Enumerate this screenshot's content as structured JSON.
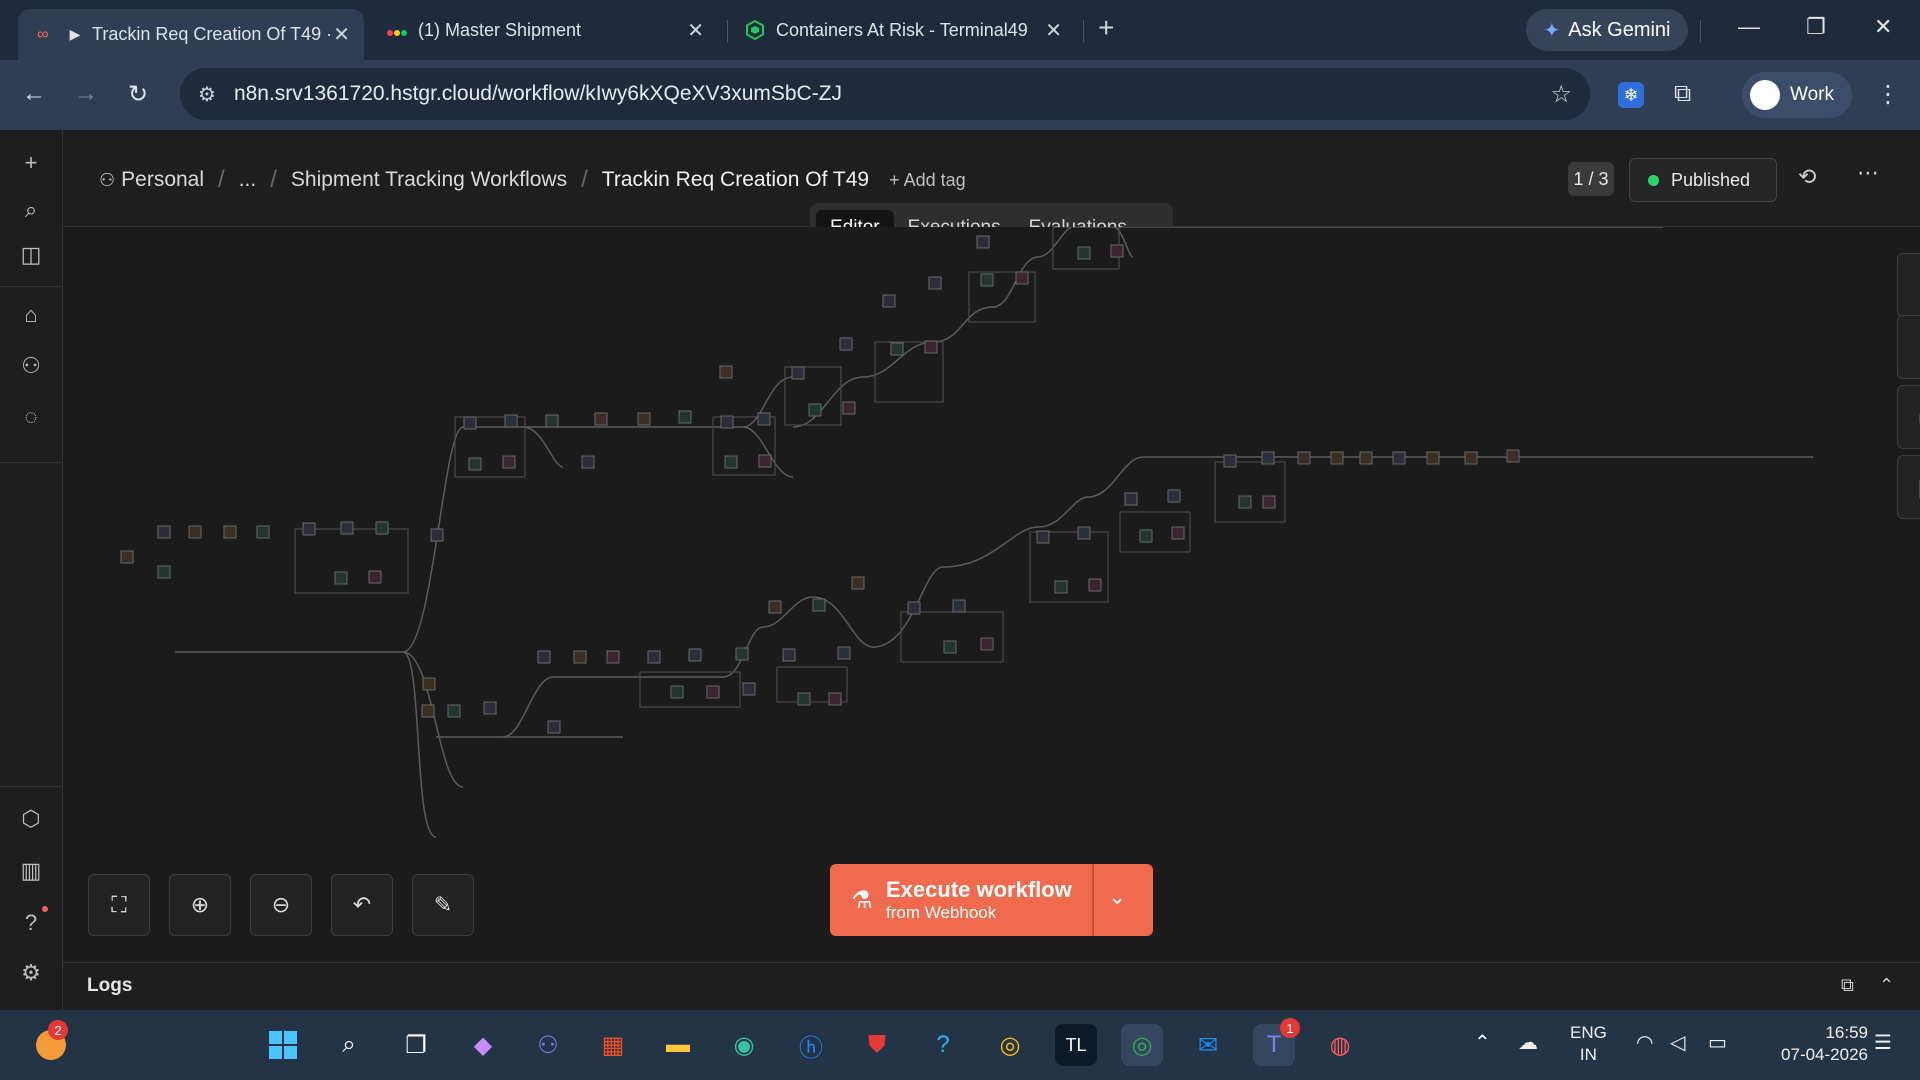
{
  "browser": {
    "tabs": [
      {
        "title": "Trackin Req Creation Of T49 ·",
        "icon": "n8n-icon",
        "playing": "▶",
        "active": true
      },
      {
        "title": "(1) Master Shipment",
        "icon": "monday-icon",
        "active": false
      },
      {
        "title": "Containers At Risk - Terminal49",
        "icon": "terminal49-icon",
        "active": false
      }
    ],
    "gemini_label": "Ask Gemini",
    "url": "n8n.srv1361720.hstgr.cloud/workflow/kIwy6kXQeXV3xumSbC-ZJ",
    "profile_label": "Work"
  },
  "header": {
    "breadcrumbs": [
      "Personal",
      "...",
      "Shipment Tracking Workflows"
    ],
    "workflow_name": "Trackin Req Creation Of T49",
    "add_tag": "+ Add tag",
    "pager": "1 / 3",
    "status": "Published",
    "status_color": "#2bd36a"
  },
  "tabs": [
    "Editor",
    "Executions",
    "Evaluations"
  ],
  "execute": {
    "title": "Execute workflow",
    "subtitle": "from Webhook",
    "color": "#f06a4d"
  },
  "logs": {
    "label": "Logs"
  },
  "taskbar": {
    "language": "ENG",
    "region": "IN",
    "time": "16:59",
    "date": "07-04-2026",
    "weather_badge": "2",
    "teams_badge": "1"
  }
}
